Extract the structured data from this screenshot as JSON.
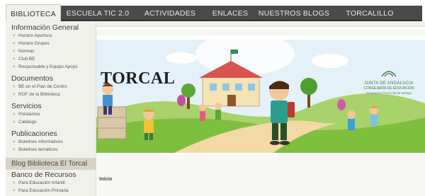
{
  "nav": {
    "tabs": [
      {
        "label": "BIBLIOTECA",
        "active": true
      },
      {
        "label": "ESCUELA TIC 2.0",
        "active": false
      },
      {
        "label": "ACTIVIDADES",
        "active": false
      },
      {
        "label": "ENLACES",
        "active": false
      },
      {
        "label": "NUESTROS BLOGS",
        "active": false
      },
      {
        "label": "TORCALILLO",
        "active": false
      }
    ]
  },
  "sidebar": {
    "sections": [
      {
        "title": "Información General",
        "items": [
          "Horario Apertura",
          "Horario Grupos",
          "Normas",
          "Club BE",
          "Responsable y Equipo Apoyo"
        ]
      },
      {
        "title": "Documentos",
        "items": [
          "BE en el Plan de Centro",
          "ROF de la Biblioteca"
        ]
      },
      {
        "title": "Servicios",
        "items": [
          "Préstamos",
          "Catálogo"
        ]
      },
      {
        "title": "Publicaciones",
        "items": [
          "Boletines informativos",
          "Boletines temáticos"
        ]
      }
    ],
    "highlight": "Blog Biblioteca El Torcal",
    "last_section": {
      "title": "Banco de Recursos",
      "items": [
        "Para Educación Infantil",
        "Para Educación Primaria"
      ]
    }
  },
  "banner": {
    "title": "TORCAL",
    "logo_line1": "JUNTA DE ANDALUCIA",
    "logo_line2": "CONSEJERÍA DE EDUCACIÓN",
    "logo_line3": "Delegación Provincial de Málaga"
  },
  "main": {
    "breadcrumb": "Inicio"
  },
  "colors": {
    "navbar": "#4a4a4a",
    "sidebar_bg": "#f1f1ec",
    "highlight_bg": "#d7d2c6",
    "sky": "#dceef8",
    "grass": "#7fbf3e"
  }
}
